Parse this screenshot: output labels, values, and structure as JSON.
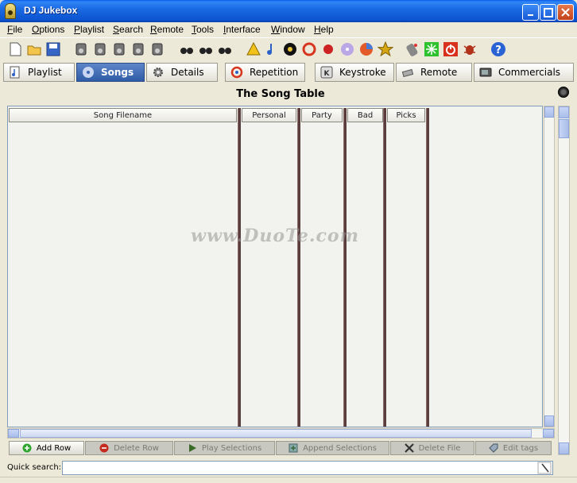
{
  "window": {
    "title": "DJ Jukebox"
  },
  "menu": [
    "File",
    "Options",
    "Playlist",
    "Search",
    "Remote",
    "Tools",
    "Interface",
    "Window",
    "Help"
  ],
  "tabs": [
    {
      "label": "Playlist"
    },
    {
      "label": "Songs"
    },
    {
      "label": "Details"
    },
    {
      "label": "Repetition"
    },
    {
      "label": "Keystroke"
    },
    {
      "label": "Remote"
    },
    {
      "label": "Commercials"
    }
  ],
  "active_tab": "Songs",
  "main": {
    "heading": "The Song Table",
    "columns": [
      "Song Filename",
      "Personal",
      "Party",
      "Bad",
      "Picks"
    ]
  },
  "actions": {
    "add_row": "Add Row",
    "delete_row": "Delete Row",
    "play_selections": "Play Selections",
    "append_selections": "Append Selections",
    "delete_file": "Delete File",
    "edit_tags": "Edit tags"
  },
  "quick_search": {
    "label": "Quick search:",
    "value": ""
  },
  "watermark": "www.DuoTe.com",
  "colors": {
    "titlebar": "#0c53d0",
    "active_tab": "#3b68b3",
    "column_separator": "#5a3e3e"
  }
}
